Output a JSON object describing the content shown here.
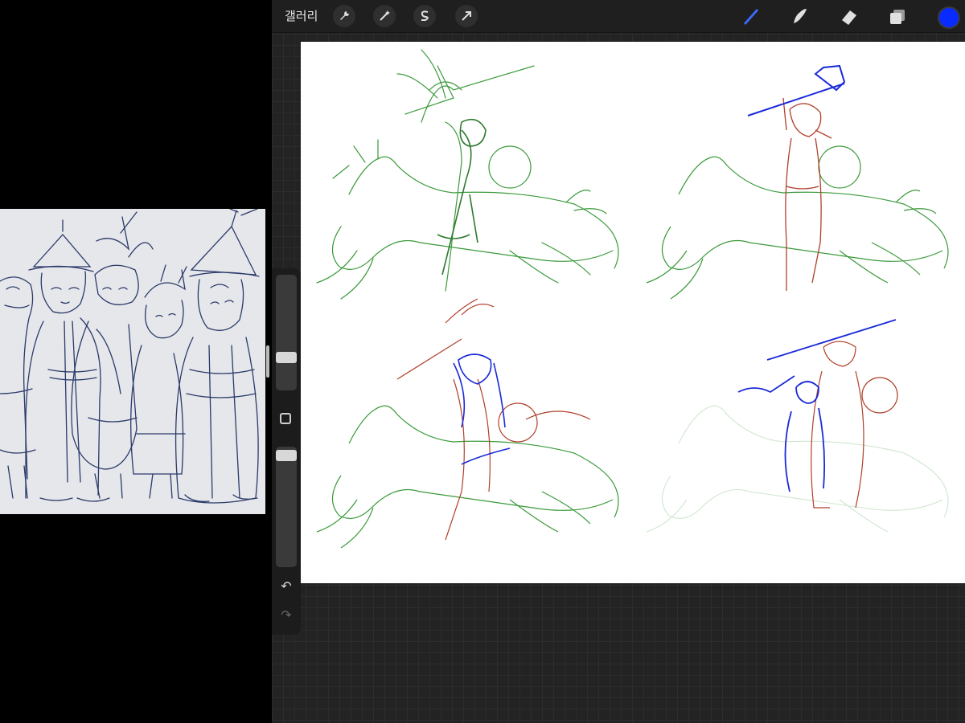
{
  "topbar": {
    "gallery_label": "갤러리",
    "left_tools": [
      "wrench-icon",
      "magic-wand-icon",
      "selection-icon",
      "transform-arrow-icon"
    ],
    "right_tools": [
      "brush-icon",
      "smudge-icon",
      "eraser-icon",
      "layers-icon"
    ],
    "active_tool": "brush-icon",
    "current_color": "#0a2bff"
  },
  "sidebar": {
    "brush_size_slider": "brush-size",
    "opacity_slider": "opacity",
    "modify_button": "modify",
    "undo": "undo",
    "redo": "redo"
  },
  "colors": {
    "sketch_green": "#3a9a3a",
    "sketch_red": "#b0402a",
    "sketch_blue": "#1a2ad8",
    "reference_ink": "#2a3a6a",
    "canvas_bg": "#ffffff"
  }
}
